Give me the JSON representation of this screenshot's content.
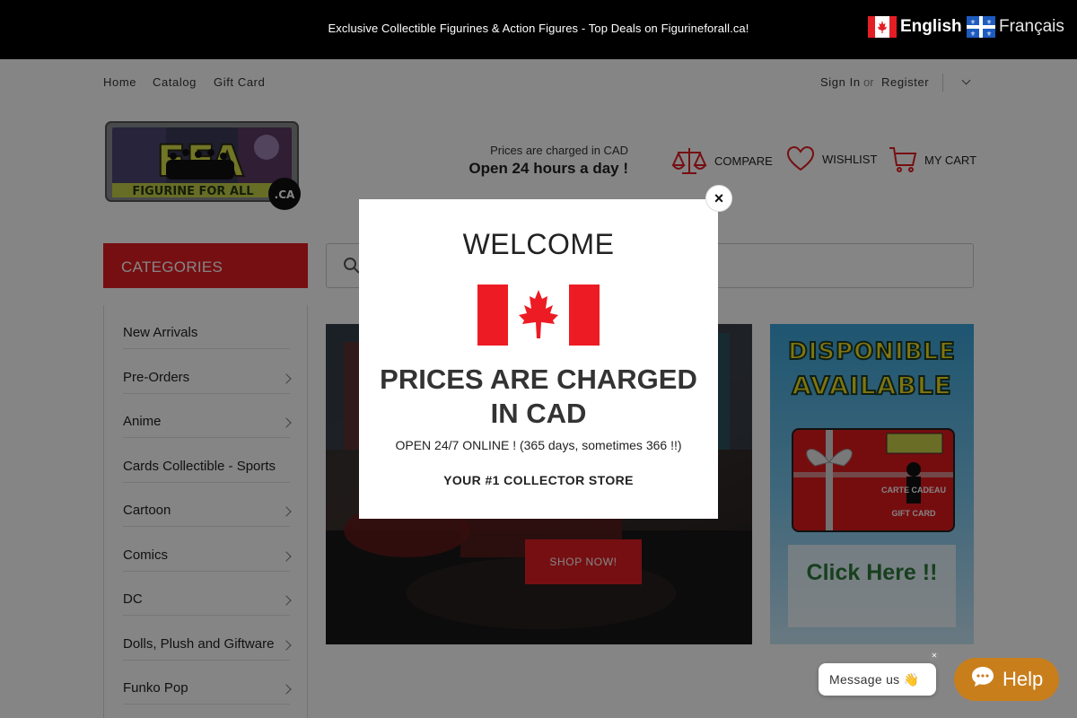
{
  "topbar": {
    "announcement": "Exclusive Collectible Figurines & Action Figures - Top Deals on Figurineforall.ca!",
    "lang_en": "English",
    "lang_fr": "Français"
  },
  "nav": {
    "home": "Home",
    "catalog": "Catalog",
    "gift_card": "Gift Card",
    "sign_in": "Sign In",
    "or": "or",
    "register": "Register"
  },
  "logo": {
    "text": "FFA",
    "subtitle": "FIGURINE FOR ALL",
    "domain": ".CA"
  },
  "header": {
    "prices_note": "Prices are charged in CAD",
    "hours": "Open 24 hours a day !",
    "compare": "COMPARE",
    "wishlist": "WISHLIST",
    "cart": "MY CART"
  },
  "categories": {
    "title": "CATEGORIES",
    "items": [
      {
        "label": "New Arrivals",
        "has_children": false
      },
      {
        "label": "Pre-Orders",
        "has_children": true
      },
      {
        "label": "Anime",
        "has_children": true
      },
      {
        "label": "Cards Collectible - Sports",
        "has_children": false
      },
      {
        "label": "Cartoon",
        "has_children": true
      },
      {
        "label": "Comics",
        "has_children": true
      },
      {
        "label": "DC",
        "has_children": true
      },
      {
        "label": "Dolls, Plush and Giftware",
        "has_children": true
      },
      {
        "label": "Funko Pop",
        "has_children": true
      }
    ]
  },
  "hero": {
    "shop_now": "SHOP NOW!"
  },
  "gift_banner": {
    "line1": "DISPONIBLE",
    "line2": "AVAILABLE",
    "card_fr": "CARTE CADEAU",
    "card_en": "GIFT CARD",
    "click_here": "Click Here !!"
  },
  "modal": {
    "welcome": "WELCOME",
    "headline": "PRICES ARE CHARGED IN CAD",
    "sub": "OPEN 24/7 ONLINE ! (365 days, sometimes 366 !!)",
    "tagline": "YOUR #1 COLLECTOR STORE",
    "close": "×"
  },
  "chat": {
    "message": "Message us 👋",
    "help": "Help"
  },
  "colors": {
    "brand_red": "#e31e24",
    "help_orange": "#c97e1c",
    "canada_red": "#ed1c24"
  }
}
